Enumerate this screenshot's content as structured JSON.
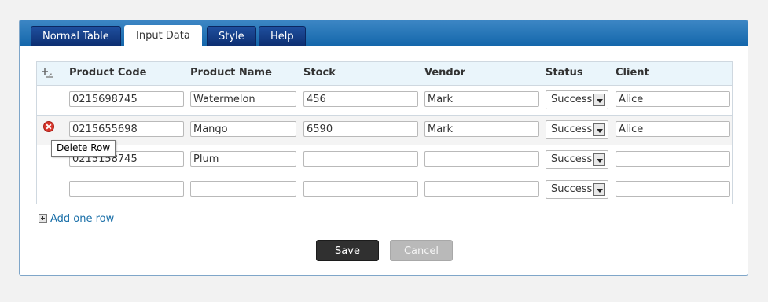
{
  "tabs": [
    {
      "label": "Normal Table",
      "active": false
    },
    {
      "label": "Input Data",
      "active": true
    },
    {
      "label": "Style",
      "active": false
    },
    {
      "label": "Help",
      "active": false
    }
  ],
  "table": {
    "columns": [
      "Product Code",
      "Product Name",
      "Stock",
      "Vendor",
      "Status",
      "Client"
    ],
    "rows": [
      {
        "code": "0215698745",
        "name": "Watermelon",
        "stock": "456",
        "vendor": "Mark",
        "status": "Success",
        "client": "Alice"
      },
      {
        "code": "0215655698",
        "name": "Mango",
        "stock": "6590",
        "vendor": "Mark",
        "status": "Success",
        "client": "Alice"
      },
      {
        "code": "0215158745",
        "name": "Plum",
        "stock": "",
        "vendor": "",
        "status": "Success",
        "client": ""
      },
      {
        "code": "",
        "name": "",
        "stock": "",
        "vendor": "",
        "status": "Success",
        "client": ""
      }
    ]
  },
  "tooltip": "Delete Row",
  "add_row_label": "Add one row",
  "buttons": {
    "save": "Save",
    "cancel": "Cancel"
  },
  "colors": {
    "tab_bar": "#1467ab",
    "tab": "#0d2f72",
    "header_bg": "#eaf5fb",
    "link": "#1a6fa8",
    "delete_icon": "#d8352b"
  },
  "icons": {
    "add_column": "add-column-icon",
    "delete_row": "delete-row-icon",
    "add_row": "plus-box-icon"
  }
}
